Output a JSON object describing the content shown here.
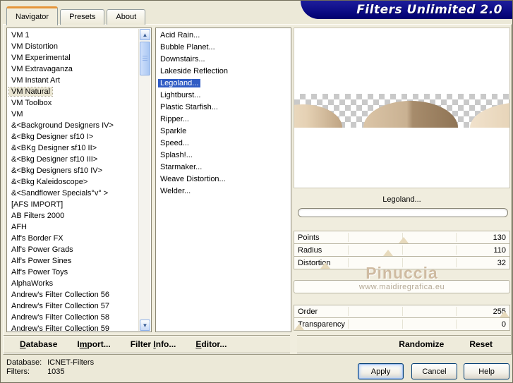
{
  "window": {
    "title": "Filters Unlimited 2.0"
  },
  "tabs": [
    {
      "label": "Navigator",
      "active": true
    },
    {
      "label": "Presets",
      "active": false
    },
    {
      "label": "About",
      "active": false
    }
  ],
  "category_list": {
    "selected_index": 5,
    "items": [
      "VM 1",
      "VM Distortion",
      "VM Experimental",
      "VM Extravaganza",
      "VM Instant Art",
      "VM Natural",
      "VM Toolbox",
      "VM",
      "&<Background Designers IV>",
      "&<Bkg Designer sf10 I>",
      "&<BKg Designer sf10 II>",
      "&<Bkg Designer sf10 III>",
      "&<Bkg Designers sf10 IV>",
      "&<Bkg Kaleidoscope>",
      "&<Sandflower Specials°v° >",
      "[AFS IMPORT]",
      "AB Filters 2000",
      "AFH",
      "Alf's Border FX",
      "Alf's Power Grads",
      "Alf's Power Sines",
      "Alf's Power Toys",
      "AlphaWorks",
      "Andrew's Filter Collection 56",
      "Andrew's Filter Collection 57",
      "Andrew's Filter Collection 58",
      "Andrew's Filter Collection 59"
    ]
  },
  "filter_list": {
    "selected_index": 4,
    "items": [
      "Acid Rain...",
      "Bubble Planet...",
      "Downstairs...",
      "Lakeside Reflection",
      "Legoland...",
      "Lightburst...",
      "Plastic Starfish...",
      "Ripper...",
      "Sparkle",
      "Speed...",
      "Splash!...",
      "Starmaker...",
      "Weave Distortion...",
      "Welder..."
    ]
  },
  "preview": {
    "caption": "Legoland...",
    "progress_percent": 0
  },
  "sliders_primary": [
    {
      "label": "Points",
      "value": 130,
      "max": 255
    },
    {
      "label": "Radius",
      "value": 110,
      "max": 255
    },
    {
      "label": "Distortion",
      "value": 32,
      "max": 255
    }
  ],
  "sliders_secondary": [
    {
      "label": "Order",
      "value": 255,
      "max": 255
    },
    {
      "label": "Transparency",
      "value": 0,
      "max": 255
    }
  ],
  "watermark": {
    "name": "Pinuccia",
    "url": "www.maidiregrafica.eu"
  },
  "toolbar": {
    "items": [
      {
        "pre": "",
        "accel": "D",
        "post": "atabase"
      },
      {
        "pre": "I",
        "accel": "m",
        "post": "port..."
      },
      {
        "pre": "Filter ",
        "accel": "I",
        "post": "nfo..."
      },
      {
        "pre": "",
        "accel": "E",
        "post": "ditor..."
      }
    ],
    "randomize": "Randomize",
    "reset": "Reset"
  },
  "status": {
    "database_label": "Database:",
    "database_value": "ICNET-Filters",
    "filters_label": "Filters:",
    "filters_value": "1035"
  },
  "action_buttons": {
    "apply": "Apply",
    "cancel": "Cancel",
    "help": "Help"
  },
  "colors": {
    "title_navy": "#0d0d86",
    "selection_blue": "#2f5bc4",
    "tab_accent_orange": "#e5953a",
    "dialog_beige": "#ece9d8",
    "checker_gray": "#c9c9c9",
    "dome_light": "#f4e7d1",
    "dome_dark": "#8f7455",
    "watermark_tan": "#cfbba1"
  }
}
